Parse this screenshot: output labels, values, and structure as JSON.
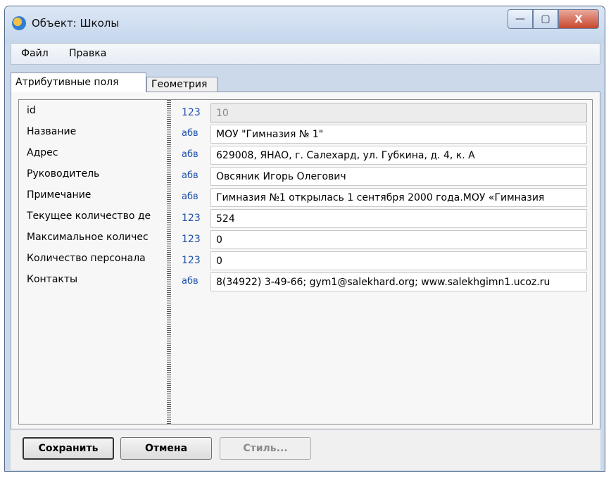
{
  "window": {
    "title": "Объект: Школы"
  },
  "window_controls": {
    "minimize": "—",
    "maximize": "▢",
    "close": "X"
  },
  "menu": [
    "Файл",
    "Правка"
  ],
  "tabs": [
    "Атрибутивные поля",
    "Геометрия"
  ],
  "fields": [
    {
      "label": "id",
      "type": "123",
      "value": "10",
      "readonly": true
    },
    {
      "label": "Название",
      "type": "абв",
      "value": "МОУ \"Гимназия № 1\""
    },
    {
      "label": "Адрес",
      "type": "абв",
      "value": "629008, ЯНАО, г. Салехард, ул. Губкина, д. 4, к. А"
    },
    {
      "label": "Руководитель",
      "type": "абв",
      "value": "Овсяник Игорь Олегович"
    },
    {
      "label": "Примечание",
      "type": "абв",
      "value": "Гимназия №1 открылась 1 сентября 2000 года.МОУ «Гимназия"
    },
    {
      "label": "Текущее количество де",
      "type": "123",
      "value": "524"
    },
    {
      "label": "Максимальное количес",
      "type": "123",
      "value": "0"
    },
    {
      "label": "Количество персонала",
      "type": "123",
      "value": "0"
    },
    {
      "label": "Контакты",
      "type": "абв",
      "value": "8(34922) 3-49-66;  gym1@salekhard.org; www.salekhgimn1.ucoz.ru"
    }
  ],
  "buttons": {
    "save": "Сохранить",
    "cancel": "Отмена",
    "style": "Стиль..."
  }
}
